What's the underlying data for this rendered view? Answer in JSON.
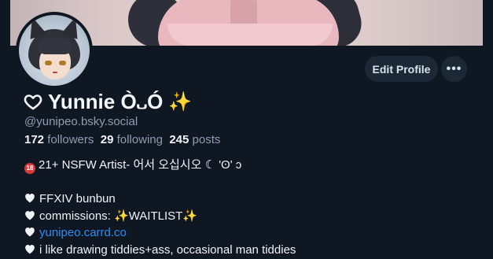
{
  "profile": {
    "display_name": "Yunnie Ò᎑Ó",
    "sparkle": "✨",
    "handle": "@yunipeo.bsky.social",
    "edit_label": "Edit Profile",
    "more_label": "•••",
    "stats": {
      "followers_count": "172",
      "followers_label": "followers",
      "following_count": "29",
      "following_label": "following",
      "posts_count": "245",
      "posts_label": "posts"
    },
    "bio": {
      "line1_badge": "18",
      "line1_text": "21+ NSFW Artist-  어서 오십시오 ☾ 'ʘ' ↄ",
      "line2": "FFXIV bunbun",
      "line3": "commissions: ✨WAITLIST✨",
      "line4_link": "yunipeo.carrd.co",
      "line5": "i like drawing tiddies+ass, occasional man tiddies"
    }
  },
  "icons": {
    "name_heart": "heart-outline-icon",
    "bio_heart": "heart-icon",
    "more": "ellipsis-icon",
    "age_badge": "18-plus-icon"
  },
  "colors": {
    "background": "#0f1722",
    "button": "#1d2836",
    "link": "#2f8df2",
    "muted": "#8e9db0"
  }
}
